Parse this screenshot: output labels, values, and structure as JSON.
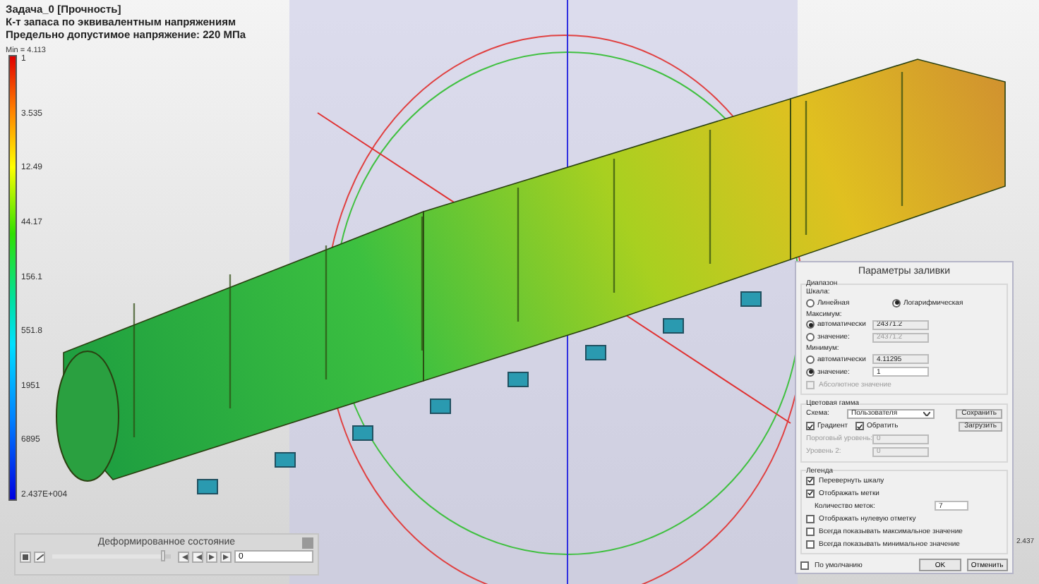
{
  "header": {
    "lines": [
      "Задача_0 [Прочность]",
      "К-т запаса по эквивалентным напряжениям",
      "Предельно допустимое напряжение: 220 МПа"
    ],
    "min_label": "Min = 4.113"
  },
  "scale": {
    "ticks": [
      "1",
      "3.535",
      "12.49",
      "44.17",
      "156.1",
      "551.8",
      "1951",
      "6895",
      "2.437E+004"
    ]
  },
  "side_value": "2.437",
  "deform_panel": {
    "title": "Деформированное состояние",
    "slider": {
      "level": 0.93
    },
    "frame_value": "0"
  },
  "dialog": {
    "title": "Параметры заливки",
    "range": {
      "legend": "Диапазон",
      "scale_label": "Шкала:",
      "scale_options": [
        {
          "label": "Линейная",
          "selected": false
        },
        {
          "label": "Логарифмическая",
          "selected": true
        }
      ],
      "max": {
        "label": "Максимум:",
        "options": [
          {
            "label": "автоматически",
            "selected": true,
            "value": "24371.2",
            "disabled": false,
            "readonly": true
          },
          {
            "label": "значение:",
            "selected": false,
            "value": "24371.2",
            "disabled": true,
            "readonly": false
          }
        ]
      },
      "min": {
        "label": "Минимум:",
        "options": [
          {
            "label": "автоматически",
            "selected": false,
            "value": "4.11295",
            "disabled": false,
            "readonly": true
          },
          {
            "label": "значение:",
            "selected": true,
            "value": "1",
            "disabled": false,
            "readonly": false
          }
        ]
      },
      "absolute": {
        "label": "Абсолютное значение",
        "checked": false,
        "disabled": true
      }
    },
    "colors": {
      "legend": "Цветовая гамма",
      "scheme_label": "Схема:",
      "scheme": "Пользователя",
      "save": "Сохранить",
      "load": "Загрузить",
      "gradient": {
        "label": "Градиент",
        "checked": true
      },
      "invert": {
        "label": "Обратить",
        "checked": true
      },
      "levels": [
        {
          "label": "Пороговый уровень:",
          "value": "0",
          "disabled": true
        },
        {
          "label": "Уровень 2:",
          "value": "0",
          "disabled": true
        }
      ]
    },
    "legend": {
      "legend": "Легенда",
      "options": [
        {
          "label": "Перевернуть шкалу",
          "checked": true
        },
        {
          "label": "Отображать метки",
          "checked": true
        }
      ],
      "count_label": "Количество меток:",
      "count": "7",
      "more": [
        {
          "label": "Отображать нулевую отметку",
          "checked": false
        },
        {
          "label": "Всегда показывать максимальное значение",
          "checked": false
        },
        {
          "label": "Всегда показывать минимальное значение",
          "checked": false
        }
      ]
    },
    "default": {
      "label": "По умолчанию",
      "checked": false
    },
    "buttons": [
      "OK",
      "Отменить"
    ]
  }
}
